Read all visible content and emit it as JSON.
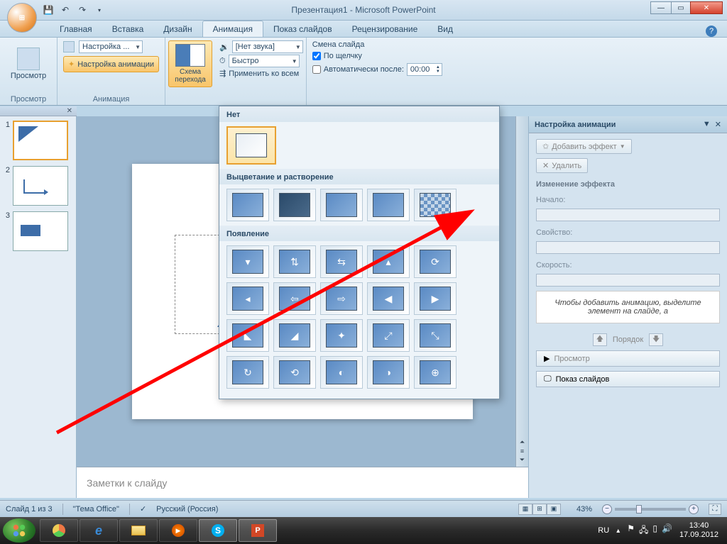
{
  "window": {
    "title": "Презентация1 - Microsoft PowerPoint"
  },
  "tabs": {
    "home": "Главная",
    "insert": "Вставка",
    "design": "Дизайн",
    "animation": "Анимация",
    "slideshow": "Показ слайдов",
    "review": "Рецензирование",
    "view": "Вид"
  },
  "ribbon": {
    "preview_group": "Просмотр",
    "preview_btn": "Просмотр",
    "anim_group": "Анимация",
    "settings_combo": "Настройка ...",
    "anim_settings_btn": "Настройка анимации",
    "scheme_btn": "Схема перехода",
    "sound_label": "[Нет звука]",
    "speed_label": "Быстро",
    "apply_all": "Применить ко всем",
    "advance_label": "Смена слайда",
    "on_click": "По щелчку",
    "auto_after": "Автоматически после:",
    "auto_time": "00:00"
  },
  "gallery": {
    "none_label": "Нет",
    "fade_label": "Выцветание и растворение",
    "appear_label": "Появление"
  },
  "anim_pane": {
    "title": "Настройка анимации",
    "add_effect": "Добавить эффект",
    "remove": "Удалить",
    "change_label": "Изменение эффекта",
    "start_label": "Начало:",
    "property_label": "Свойство:",
    "speed_label": "Скорость:",
    "hint": "Чтобы добавить анимацию, выделите элемент на слайде, а",
    "order": "Порядок",
    "preview": "Просмотр",
    "slideshow": "Показ слайдов"
  },
  "notes": {
    "placeholder": "Заметки к слайду"
  },
  "status": {
    "slide": "Слайд 1 из 3",
    "theme": "\"Тема Office\"",
    "lang": "Русский (Россия)",
    "zoom": "43%"
  },
  "taskbar": {
    "lang": "RU",
    "time": "13:40",
    "date": "17.09.2012"
  }
}
